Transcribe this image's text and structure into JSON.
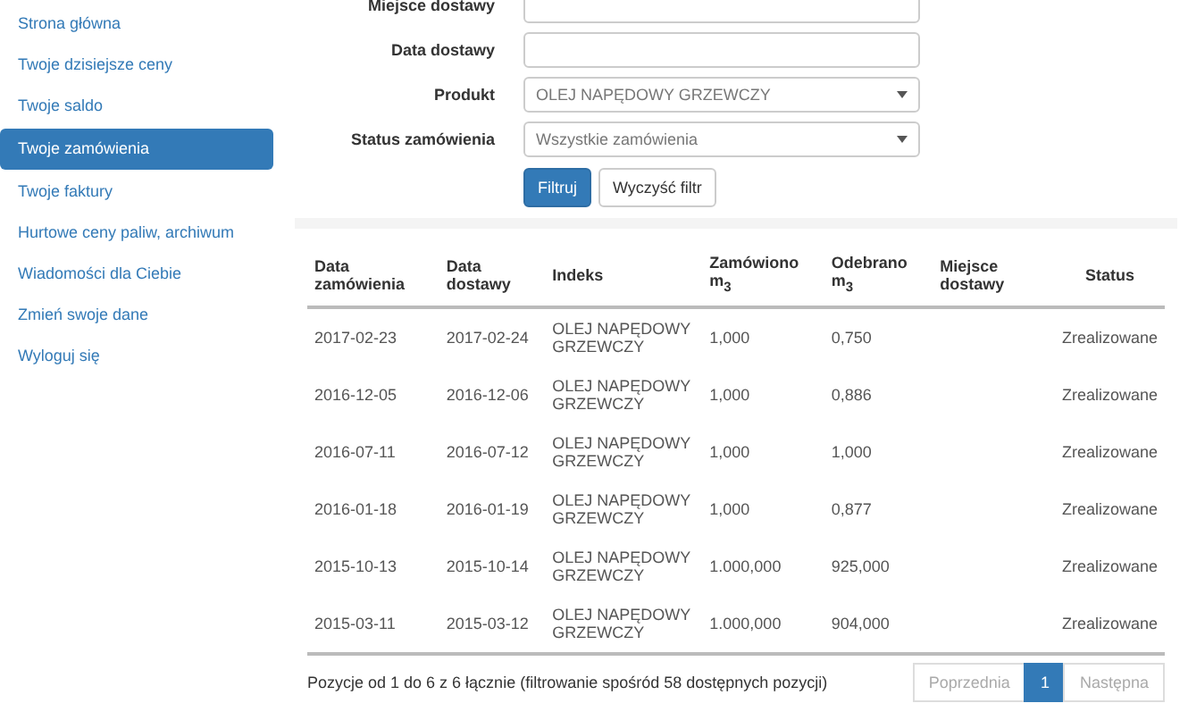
{
  "sidebar": {
    "items": [
      {
        "label": "Strona główna",
        "selected": false
      },
      {
        "label": "Twoje dzisiejsze ceny",
        "selected": false
      },
      {
        "label": "Twoje saldo",
        "selected": false
      },
      {
        "label": "Twoje zamówienia",
        "selected": true
      },
      {
        "label": "Twoje faktury",
        "selected": false
      },
      {
        "label": "Hurtowe ceny paliw, archiwum",
        "selected": false
      },
      {
        "label": "Wiadomości dla Ciebie",
        "selected": false
      },
      {
        "label": "Zmień swoje dane",
        "selected": false
      },
      {
        "label": "Wyloguj się",
        "selected": false
      }
    ]
  },
  "filters": [
    {
      "kind": "text",
      "label": "Miejsce dostawy"
    },
    {
      "kind": "text",
      "label": "Data dostawy"
    },
    {
      "kind": "select",
      "label": "Produkt",
      "value": "OLEJ NAPĘDOWY GRZEWCZY"
    },
    {
      "kind": "select",
      "label": "Status zamówienia",
      "value": "Wszystkie zamówienia"
    }
  ],
  "buttons": [
    {
      "label": "Filtruj",
      "kind": "primary"
    },
    {
      "label": "Wyczyść filtr",
      "kind": "default"
    }
  ],
  "table": {
    "columns": [
      "Data zamówienia",
      "Data dostawy",
      "Indeks",
      "Zamówiono m$_{3}$",
      "Odebrano m$_{3}$",
      "Miejsce dostawy",
      "Status"
    ],
    "rows": [
      [
        "2017-02-23",
        "2017-02-24",
        "OLEJ NAPĘDOWY GRZEWCZY",
        "1,000",
        "0,750",
        null,
        "Zrealizowane"
      ],
      [
        "2016-12-05",
        "2016-12-06",
        "OLEJ NAPĘDOWY GRZEWCZY",
        "1,000",
        "0,886",
        null,
        "Zrealizowane"
      ],
      [
        "2016-07-11",
        "2016-07-12",
        "OLEJ NAPĘDOWY GRZEWCZY",
        "1,000",
        "1,000",
        null,
        "Zrealizowane"
      ],
      [
        "2016-01-18",
        "2016-01-19",
        "OLEJ NAPĘDOWY GRZEWCZY",
        "1,000",
        "0,877",
        null,
        "Zrealizowane"
      ],
      [
        "2015-10-13",
        "2015-10-14",
        "OLEJ NAPĘDOWY GRZEWCZY",
        "1.000,000",
        "925,000",
        null,
        "Zrealizowane"
      ],
      [
        "2015-03-11",
        "2015-03-12",
        "OLEJ NAPĘDOWY GRZEWCZY",
        "1.000,000",
        "904,000",
        null,
        "Zrealizowane"
      ]
    ]
  },
  "footer": {
    "info": "Pozycje od 1 do 6 z 6 łącznie (filtrowanie spośród 58 dostępnych pozycji)",
    "pagination": [
      {
        "label": "Poprzednia",
        "selected": false,
        "disabled": true
      },
      {
        "label": "1",
        "selected": true,
        "disabled": false
      },
      {
        "label": "Następna",
        "selected": false,
        "disabled": true
      }
    ]
  }
}
